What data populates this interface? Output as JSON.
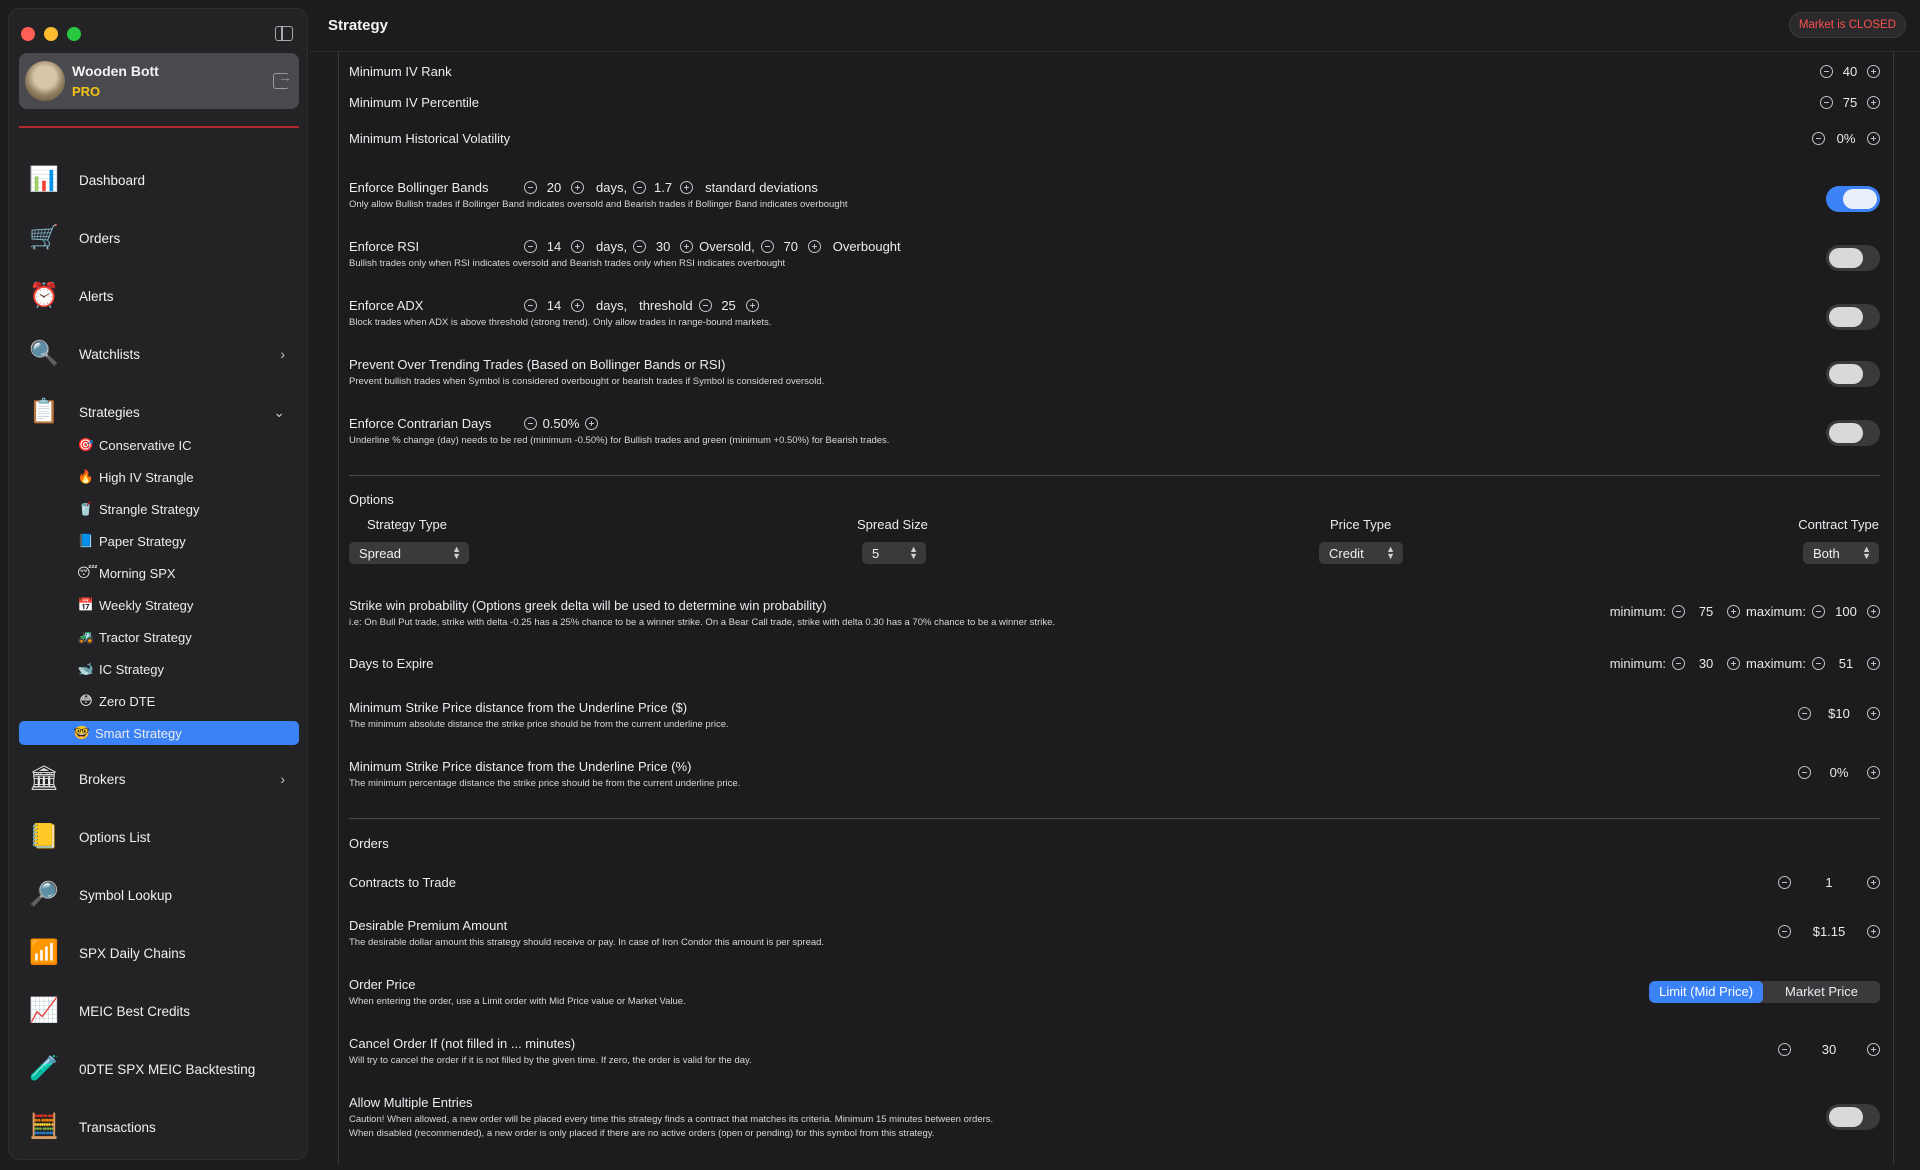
{
  "window": {
    "title": "Strategy"
  },
  "market_status": "Market is CLOSED",
  "user": {
    "name": "Wooden Bott",
    "badge": "PRO"
  },
  "nav": [
    {
      "label": "Dashboard",
      "icon": "dashboard-chart-icon",
      "chevron": ""
    },
    {
      "label": "Orders",
      "icon": "cart-icon",
      "chevron": ""
    },
    {
      "label": "Alerts",
      "icon": "alarm-clock-icon",
      "chevron": ""
    },
    {
      "label": "Watchlists",
      "icon": "watchlist-icon",
      "chevron": "›"
    },
    {
      "label": "Strategies",
      "icon": "strategy-board-icon",
      "chevron": "⌄"
    }
  ],
  "strategies": [
    {
      "label": "Conservative IC",
      "icon": "🎯"
    },
    {
      "label": "High IV Strangle",
      "icon": "🔥"
    },
    {
      "label": "Strangle Strategy",
      "icon": "🥤"
    },
    {
      "label": "Paper Strategy",
      "icon": "📘"
    },
    {
      "label": "Morning SPX",
      "icon": "😴"
    },
    {
      "label": "Weekly Strategy",
      "icon": "📅"
    },
    {
      "label": "Tractor Strategy",
      "icon": "🚜"
    },
    {
      "label": "IC Strategy",
      "icon": "🐋"
    },
    {
      "label": "Zero DTE",
      "icon": "😳"
    },
    {
      "label": "Smart Strategy",
      "icon": "🤓"
    }
  ],
  "nav_bottom": [
    {
      "label": "Brokers",
      "icon": "bank-icon",
      "chevron": "›"
    },
    {
      "label": "Options List",
      "icon": "notepad-icon",
      "chevron": ""
    },
    {
      "label": "Symbol Lookup",
      "icon": "magnifier-globe-icon",
      "chevron": ""
    },
    {
      "label": "SPX Daily Chains",
      "icon": "bar-chart-icon",
      "chevron": ""
    },
    {
      "label": "MEIC Best Credits",
      "icon": "bar-chart-coin-icon",
      "chevron": ""
    },
    {
      "label": "0DTE SPX MEIC Backtesting",
      "icon": "flask-icon",
      "chevron": ""
    },
    {
      "label": "Transactions",
      "icon": "calculator-icon",
      "chevron": ""
    }
  ],
  "filters": {
    "iv_rank": {
      "label": "Minimum IV Rank",
      "value": "40"
    },
    "iv_percentile": {
      "label": "Minimum IV Percentile",
      "value": "75"
    },
    "hist_vol": {
      "label": "Minimum Historical Volatility",
      "value": "0%"
    },
    "bollinger": {
      "label": "Enforce Bollinger Bands",
      "days": "20",
      "days_word": "days,",
      "std": "1.7",
      "std_word": "standard deviations",
      "desc": "Only allow Bullish trades if Bollinger Band indicates oversold and Bearish trades if Bollinger Band indicates overbought",
      "enabled": true
    },
    "rsi": {
      "label": "Enforce RSI",
      "days": "14",
      "days_word": "days,",
      "oversold": "30",
      "oversold_word": "Oversold,",
      "overbought": "70",
      "overbought_word": "Overbought",
      "desc": "Bullish trades only when RSI indicates oversold and Bearish trades only when RSI indicates overbought",
      "enabled": false
    },
    "adx": {
      "label": "Enforce ADX",
      "days": "14",
      "days_word": "days,",
      "threshold_word": "threshold",
      "threshold": "25",
      "desc": "Block trades when ADX is above threshold (strong trend). Only allow trades in range-bound markets.",
      "enabled": false
    },
    "over_trending": {
      "label": "Prevent Over Trending Trades (Based on Bollinger Bands or RSI)",
      "desc": "Prevent bullish trades when Symbol is considered overbought or bearish trades if Symbol is considered oversold.",
      "enabled": false
    },
    "contrarian": {
      "label": "Enforce Contrarian Days",
      "value": "0.50%",
      "desc": "Underline % change (day) needs to be red (minimum -0.50%) for Bullish trades and green (minimum +0.50%) for Bearish trades.",
      "enabled": false
    }
  },
  "options": {
    "section": "Options",
    "strategy_type": {
      "label": "Strategy Type",
      "value": "Spread"
    },
    "spread_size": {
      "label": "Spread Size",
      "value": "5"
    },
    "price_type": {
      "label": "Price Type",
      "value": "Credit"
    },
    "contract_type": {
      "label": "Contract Type",
      "value": "Both"
    },
    "win_prob": {
      "label": "Strike win probability (Options greek delta will be used to determine win probability)",
      "desc": "i.e: On Bull Put trade, strike with delta -0.25 has a 25% chance to be a winner strike. On a Bear Call trade, strike with delta 0.30 has a 70% chance to be a winner strike.",
      "min_label": "minimum:",
      "min": "75",
      "max_label": "maximum:",
      "max": "100"
    },
    "dte": {
      "label": "Days to Expire",
      "min_label": "minimum:",
      "min": "30",
      "max_label": "maximum:",
      "max": "51"
    },
    "strike_dist_abs": {
      "label": "Minimum Strike Price distance from the Underline Price ($)",
      "desc": "The minimum absolute distance the strike price should be from the current underline price.",
      "value": "$10"
    },
    "strike_dist_pct": {
      "label": "Minimum Strike Price distance from the Underline Price (%)",
      "desc": "The minimum percentage distance the strike price should be from the current underline price.",
      "value": "0%"
    }
  },
  "orders": {
    "section": "Orders",
    "contracts": {
      "label": "Contracts to Trade",
      "value": "1"
    },
    "premium": {
      "label": "Desirable Premium Amount",
      "desc": "The desirable dollar amount this strategy should receive or pay. In case of Iron Condor this amount is per spread.",
      "value": "$1.15"
    },
    "order_price": {
      "label": "Order Price",
      "desc": "When entering the order, use a Limit order with Mid Price value or Market Value.",
      "opt_limit": "Limit (Mid Price)",
      "opt_market": "Market Price",
      "selected": "Limit (Mid Price)"
    },
    "cancel": {
      "label": "Cancel Order If (not filled in ... minutes)",
      "desc": "Will try to cancel the order if it is not filled by the given time. If zero, the order is valid for the day.",
      "value": "30"
    },
    "multiple": {
      "label": "Allow Multiple Entries",
      "desc1": "Caution! When allowed, a new order will be placed every time this strategy finds a contract that matches its criteria. Minimum 15 minutes between orders.",
      "desc2": "When disabled (recommended), a new order is only placed if there are no active orders (open or pending) for this symbol from this strategy.",
      "enabled": false
    }
  },
  "colors": {
    "accent": "#3b82f6",
    "market_closed": "#ff4f4f",
    "pro": "#f0c419",
    "divider": "#b3262f"
  }
}
